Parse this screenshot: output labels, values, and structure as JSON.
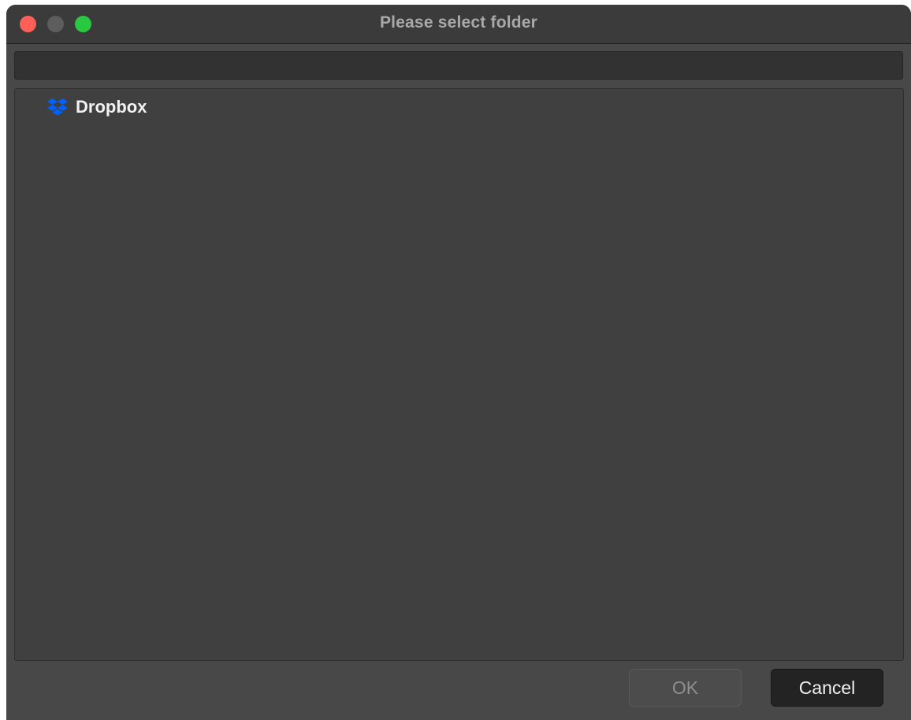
{
  "window": {
    "title": "Please select folder"
  },
  "path_field": {
    "value": "",
    "placeholder": ""
  },
  "tree": {
    "items": [
      {
        "label": "Dropbox",
        "icon": "dropbox-icon"
      }
    ]
  },
  "buttons": {
    "ok_label": "OK",
    "cancel_label": "Cancel"
  },
  "colors": {
    "close": "#ff5f57",
    "minimize_disabled": "#5d5d5d",
    "zoom": "#28c840",
    "dropbox_brand": "#0061fe"
  }
}
